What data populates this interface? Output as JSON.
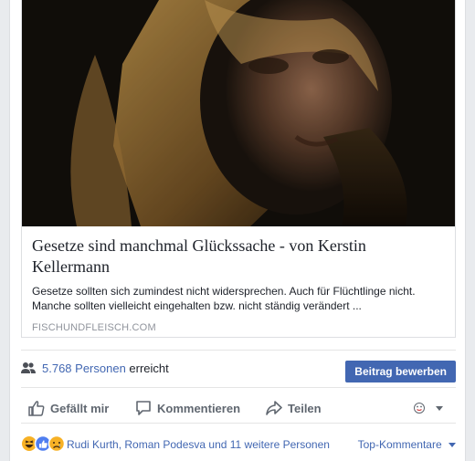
{
  "link": {
    "title": "Gesetze sind manchmal Glückssache - von Kerstin Kellermann",
    "description": "Gesetze sollten sich zumindest nicht widersprechen. Auch für Flüchtlinge nicht. Manche sollten vielleicht eingehalten bzw. nicht ständig verändert ...",
    "domain": "FISCHUNDFLEISCH.COM",
    "image_icon": "portrait-photo"
  },
  "reach": {
    "count": "5.768 Personen",
    "suffix": " erreicht",
    "icon": "people-icon",
    "boost_label": "Beitrag bewerben"
  },
  "actions": {
    "like": "Gefällt mir",
    "comment": "Kommentieren",
    "share": "Teilen",
    "reaction_selector_icon": "reaction-selector-icon"
  },
  "reactions": {
    "icons": [
      "haha-icon",
      "like-icon",
      "sad-icon"
    ],
    "people": "Rudi Kurth, Roman Podesva und 11 weitere Personen",
    "sort_label": "Top-Kommentare"
  },
  "colors": {
    "accent": "#4267b2",
    "text": "#1d2129",
    "muted": "#606770",
    "background": "#e9ebee"
  }
}
